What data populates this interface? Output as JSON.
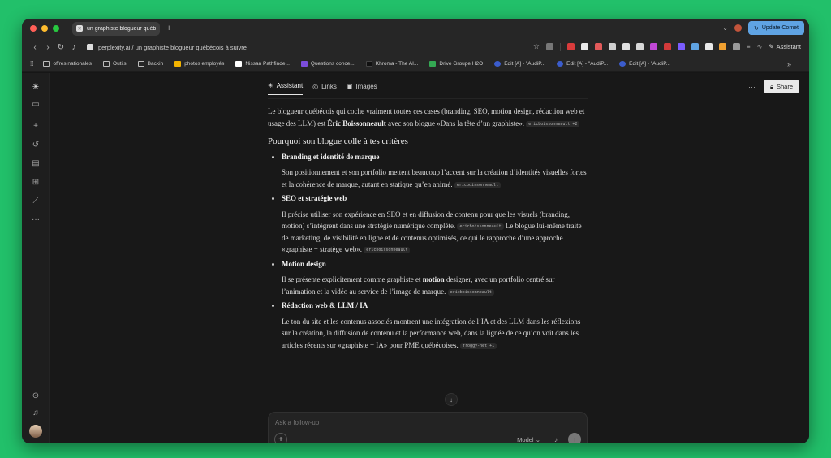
{
  "browser": {
    "tab_title": "un graphiste blogueur québé",
    "new_tab": "+",
    "update_button": "Update Comet",
    "url": "perplexity.ai / un graphiste blogueur québécois à suivre",
    "assistant_label": "Assistant"
  },
  "bookmarks": [
    {
      "label": "offres nationales",
      "icon": "folder-icon",
      "color": ""
    },
    {
      "label": "Outils",
      "icon": "folder-icon",
      "color": ""
    },
    {
      "label": "Backin",
      "icon": "folder-icon",
      "color": ""
    },
    {
      "label": "photos employés",
      "icon": "drive-icon",
      "color": "#f4b400"
    },
    {
      "label": "Nissan Pathfinde...",
      "icon": "page-icon",
      "color": "#ffffff"
    },
    {
      "label": "Questions conce...",
      "icon": "form-icon",
      "color": "#7b4ddb"
    },
    {
      "label": "Khroma - The AI...",
      "icon": "khroma-icon",
      "color": "#111111"
    },
    {
      "label": "Drive Groupe H2O",
      "icon": "drive-icon",
      "color": "#34a853"
    },
    {
      "label": "Edit [A] - \"AudiP...",
      "icon": "edit-icon",
      "color": "#3b5ccc"
    },
    {
      "label": "Edit [A] - \"AudiP...",
      "icon": "edit-icon",
      "color": "#3b5ccc"
    },
    {
      "label": "Edit [A] - \"AudiP...",
      "icon": "edit-icon",
      "color": "#3b5ccc"
    }
  ],
  "tabs": {
    "assistant": "Assistant",
    "links": "Links",
    "images": "Images",
    "share": "Share"
  },
  "answer": {
    "intro_pre": "Le blogueur québécois qui coche vraiment toutes ces cases (branding, SEO, motion design, rédaction web et usage des LLM) est ",
    "intro_name": "Éric Boissonneault",
    "intro_post": " avec son blogue «Dans la tête d’un graphiste».",
    "intro_cite": "ericboissonneault +2",
    "heading": "Pourquoi son blogue colle à tes critères",
    "items": [
      {
        "title": "Branding et identité de marque",
        "body": "Son positionnement et son portfolio mettent beaucoup l’accent sur la création d’identités visuelles fortes et la cohérence de marque, autant en statique qu’en animé.",
        "cite": "ericboissonneault"
      },
      {
        "title": "SEO et stratégie web",
        "body": "Il précise utiliser son expérience en SEO et en diffusion de contenu pour que les visuels (branding, motion) s’intègrent dans une stratégie numérique complète.",
        "cite": "ericboissonneault",
        "body2": "Le blogue lui-même traite de marketing, de visibilité en ligne et de contenus optimisés, ce qui le rapproche d’une approche «graphiste + stratège web».",
        "cite2": "ericboissonneault"
      },
      {
        "title": "Motion design",
        "body_pre": "Il se présente explicitement comme graphiste et ",
        "body_bold": "motion",
        "body_post": " designer, avec un portfolio centré sur l’animation et la vidéo au service de l’image de marque.",
        "cite": "ericboissonneault"
      },
      {
        "title": "Rédaction web & LLM / IA",
        "body": "Le ton du site et les contenus associés montrent une intégration de l’IA et des LLM dans les réflexions sur la création, la diffusion de contenu et la performance web, dans la lignée de ce qu’on voit dans les articles récents sur «graphiste + IA» pour PME québécoises.",
        "cite": "froggy-net +1"
      }
    ]
  },
  "composer": {
    "placeholder": "Ask a follow-up",
    "model_label": "Model"
  }
}
